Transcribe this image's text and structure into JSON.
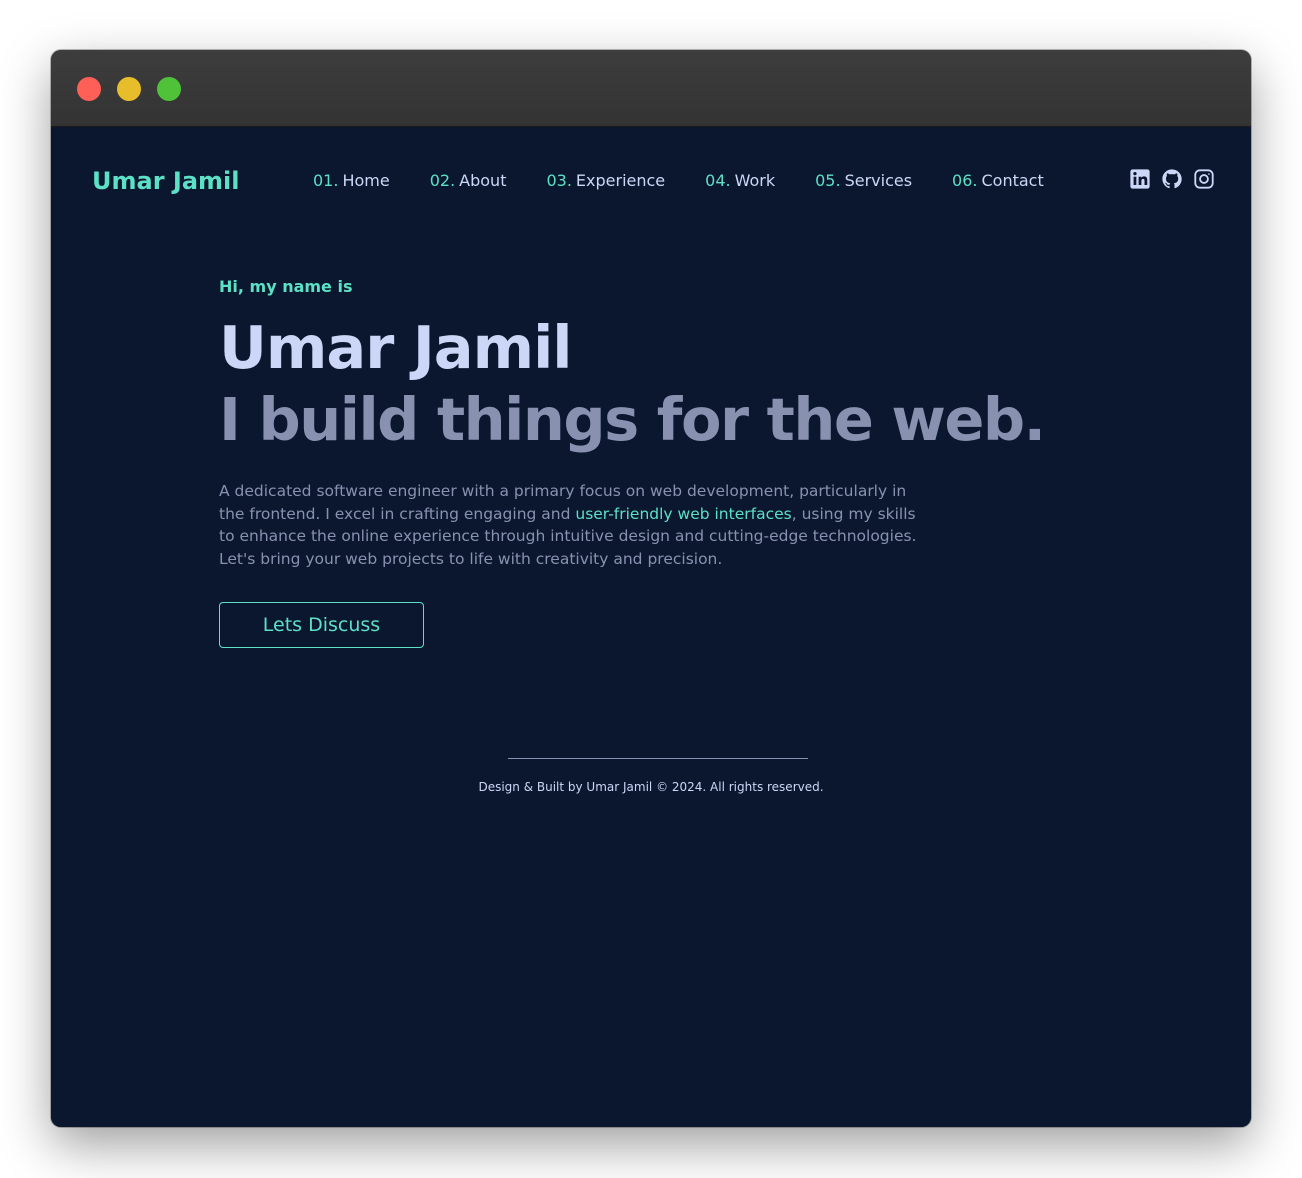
{
  "colors": {
    "background": "#0b172f",
    "accent": "#5ce1c6",
    "heading": "#ccd6f6",
    "muted": "#8892b0",
    "nav_text": "#ccd6f6",
    "divider": "#8892b0"
  },
  "header": {
    "logo": "Umar Jamil",
    "nav": [
      {
        "num": "01.",
        "label": "Home"
      },
      {
        "num": "02.",
        "label": "About"
      },
      {
        "num": "03.",
        "label": "Experience"
      },
      {
        "num": "04.",
        "label": "Work"
      },
      {
        "num": "05.",
        "label": "Services"
      },
      {
        "num": "06.",
        "label": "Contact"
      }
    ],
    "socials": [
      "linkedin-icon",
      "github-icon",
      "instagram-icon"
    ]
  },
  "hero": {
    "greeting": "Hi, my name is",
    "name": "Umar Jamil",
    "tagline": "I build things for the web.",
    "description_part1": "A dedicated software engineer with a primary focus on web development, particularly in the frontend. I excel in crafting engaging and ",
    "description_highlight": "user-friendly web interfaces",
    "description_part2": ", using my skills to enhance the online experience through intuitive design and cutting-edge technologies. Let's bring your web projects to life with creativity and precision.",
    "cta_label": "Lets Discuss"
  },
  "footer": {
    "text": "Design & Built by Umar Jamil © 2024. All rights reserved."
  }
}
